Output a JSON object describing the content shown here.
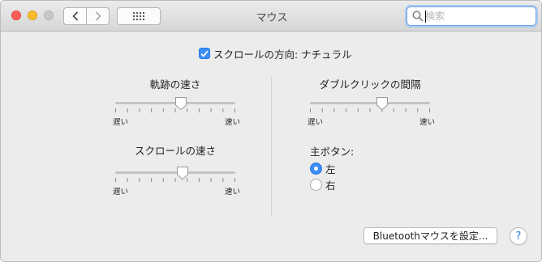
{
  "window": {
    "title": "マウス"
  },
  "search": {
    "placeholder": "検索",
    "value": ""
  },
  "scroll_direction": {
    "label": "スクロールの方向: ナチュラル",
    "checked": true
  },
  "tracking_speed": {
    "title": "軌跡の速さ",
    "min_label": "遅い",
    "max_label": "速い",
    "value": 0.55
  },
  "double_click": {
    "title": "ダブルクリックの間隔",
    "min_label": "遅い",
    "max_label": "速い",
    "value": 0.6
  },
  "scrolling_speed": {
    "title": "スクロールの速さ",
    "min_label": "遅い",
    "max_label": "速い",
    "value": 0.56
  },
  "primary_button": {
    "title": "主ボタン:",
    "options": [
      "左",
      "右"
    ],
    "selected": "左"
  },
  "footer": {
    "bluetooth_button": "Bluetoothマウスを設定...",
    "help": "?"
  },
  "colors": {
    "accent": "#3b8ff6",
    "close": "#fc5f57",
    "minimize": "#fdbc2e",
    "disabled": "#c8c8c8"
  }
}
